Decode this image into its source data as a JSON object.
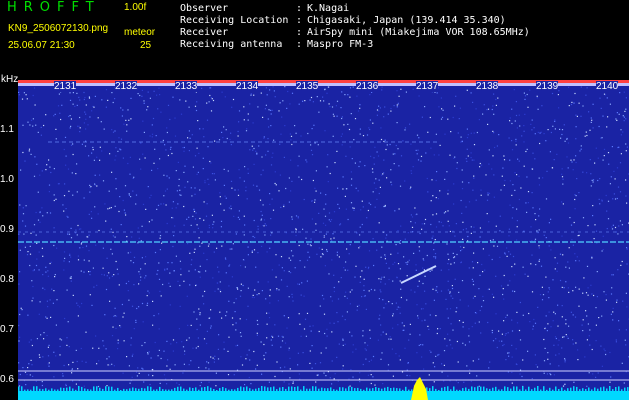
{
  "header": {
    "app_title": "HROFFT",
    "version": "1.00f",
    "filename": "KN9_2506072130.png",
    "mode": "meteor",
    "datetime": "25.06.07 21:30",
    "count": "25"
  },
  "info": [
    {
      "label": "Observer",
      "value": "K.Nagai"
    },
    {
      "label": "Receiving Location",
      "value": "Chigasaki, Japan (139.414 35.340)"
    },
    {
      "label": "Receiver",
      "value": "AirSpy mini (Miakejima VOR 108.65MHz)"
    },
    {
      "label": "Receiving antenna",
      "value": "Maspro FM-3"
    }
  ],
  "axis": {
    "unit": "kHz",
    "y_ticks": [
      "1.1",
      "1.0",
      "0.9",
      "0.8",
      "0.7",
      "0.6"
    ],
    "x_ticks": [
      "2131",
      "2132",
      "2133",
      "2134",
      "2135",
      "2136",
      "2137",
      "2138",
      "2139",
      "2140"
    ]
  },
  "colors": {
    "background": "#1a23a4",
    "signal": "#4fd0ff",
    "baseline": "#00d8ff",
    "burst": "#ffff00",
    "top_band": "#ff4040"
  }
}
